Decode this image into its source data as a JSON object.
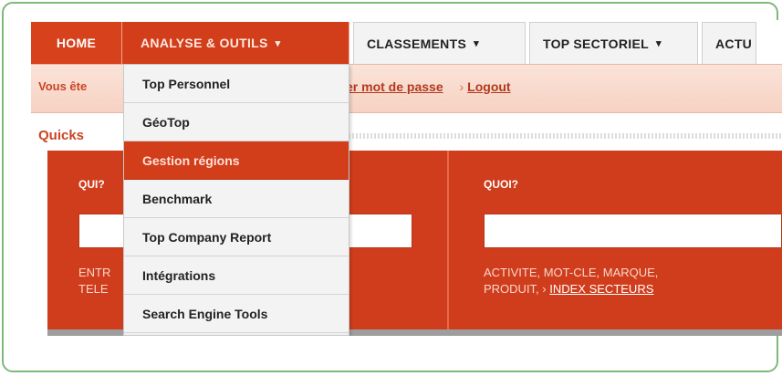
{
  "nav": {
    "home": "HOME",
    "analyse": "ANALYSE & OUTILS",
    "classements": "CLASSEMENTS",
    "top_sectoriel": "TOP SECTORIEL",
    "actu": "ACTU",
    "caret": "▾"
  },
  "login": {
    "vous": "Vous ête",
    "password_link": "er mot de passe",
    "logout": "Logout",
    "arrow": "›"
  },
  "dropdown": {
    "items": [
      {
        "label": "Top Personnel",
        "active": false
      },
      {
        "label": "GéoTop",
        "active": false
      },
      {
        "label": "Gestion régions",
        "active": true
      },
      {
        "label": "Benchmark",
        "active": false
      },
      {
        "label": "Top Company Report",
        "active": false
      },
      {
        "label": "Intégrations",
        "active": false
      },
      {
        "label": "Search Engine Tools",
        "active": false
      }
    ]
  },
  "quicksearch": {
    "title": "Quicks",
    "qui_label": "QUI?",
    "quoi_label": "QUOI?",
    "qui_hint_line1": "ENTR",
    "qui_hint_line2": "TELE",
    "quoi_hint_line1": "ACTIVITE, MOT-CLE, MARQUE,",
    "quoi_hint_line2_prefix": "PRODUIT, ›",
    "quoi_hint_link": "INDEX SECTEURS"
  },
  "colors": {
    "accent": "#d23d1a",
    "frame": "#7fb87a"
  }
}
